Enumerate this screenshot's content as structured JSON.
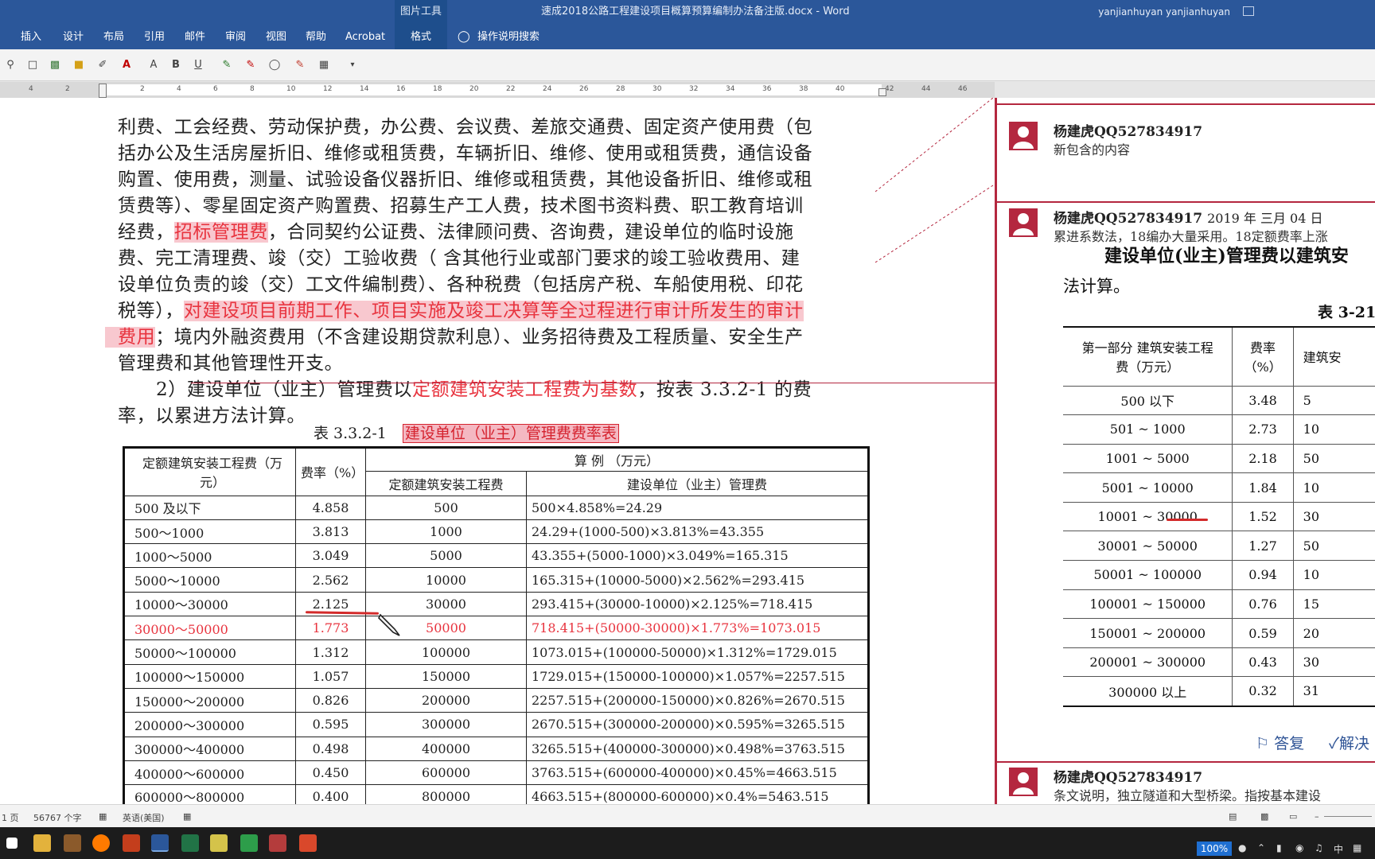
{
  "titlebar": {
    "context_tab": "图片工具",
    "doc_title": "速成2018公路工程建设项目概算预算编制办法备注版.docx  -  Word",
    "user": "yanjianhuyan yanjianhuyan"
  },
  "ribbon": {
    "tabs": [
      "插入",
      "设计",
      "布局",
      "引用",
      "邮件",
      "审阅",
      "视图",
      "帮助",
      "Acrobat",
      "格式"
    ],
    "tellme": "操作说明搜索"
  },
  "ruler": {
    "numbers": [
      "4",
      "2",
      "2",
      "4",
      "6",
      "8",
      "10",
      "12",
      "14",
      "16",
      "18",
      "20",
      "22",
      "24",
      "26",
      "28",
      "30",
      "32",
      "34",
      "36",
      "38",
      "40",
      "42",
      "44",
      "46"
    ]
  },
  "body": {
    "line1": "利费、工会经费、劳动保护费，办公费、会议费、差旅交通费、固定资产使用费（包",
    "line2": "括办公及生活房屋折旧、维修或租赁费，车辆折旧、维修、使用或租赁费，通信设备",
    "line3": "购置、使用费，测量、试验设备仪器折旧、维修或租赁费，其他设备折旧、维修或租",
    "line4": "赁费等）、零星固定资产购置费、招募生产工人费，技术图书资料费、职工教育培训",
    "line5_a": "经费，",
    "line5_hl": "招标管理费",
    "line5_b": "，合同契约公证费、法律顾问费、咨询费，建设单位的临时设施",
    "line6": "费、完工清理费、竣（交）工验收费（ 含其他行业或部门要求的竣工验收费用、建",
    "line7": "设单位负责的竣（交）工文件编制费）、各种税费（包括房产税、车船使用税、印花",
    "line8_a": "税等），",
    "line8_hl": "对建设项目前期工作、项目实施及竣工决算等全过程进行审计所发生的审计",
    "line9_hl": "费用",
    "line9_b": "；境内外融资费用（不含建设期贷款利息）、业务招待费及工程质量、安全生产",
    "line10": "管理费和其他管理性开支。",
    "para2_a": "2）建设单位（业主）管理费以",
    "para2_red": "定额建筑安装工程费为基数",
    "para2_b": "，按表 3.3.2-1 的费",
    "para2_line2": "率，以累进方法计算。",
    "caption_no": "表 3.3.2-1",
    "caption_title": "建设单位（业主）管理费费率表"
  },
  "fee_table": {
    "headers": {
      "col1": "定额建筑安装工程费（万元）",
      "col2": "费率（%）",
      "example": "算    例  （万元）",
      "sub1": "定额建筑安装工程费",
      "sub2": "建设单位（业主）管理费"
    },
    "rows": [
      [
        "500 及以下",
        "4.858",
        "500",
        "500×4.858%=24.29"
      ],
      [
        "500～1000",
        "3.813",
        "1000",
        "24.29+(1000-500)×3.813%=43.355"
      ],
      [
        "1000～5000",
        "3.049",
        "5000",
        "43.355+(5000-1000)×3.049%=165.315"
      ],
      [
        "5000～10000",
        "2.562",
        "10000",
        "165.315+(10000-5000)×2.562%=293.415"
      ],
      [
        "10000～30000",
        "2.125",
        "30000",
        "293.415+(30000-10000)×2.125%=718.415"
      ],
      [
        "30000～50000",
        "1.773",
        "50000",
        "718.415+(50000-30000)×1.773%=1073.015"
      ],
      [
        "50000～100000",
        "1.312",
        "100000",
        "1073.015+(100000-50000)×1.312%=1729.015"
      ],
      [
        "100000～150000",
        "1.057",
        "150000",
        "1729.015+(150000-100000)×1.057%=2257.515"
      ],
      [
        "150000～200000",
        "0.826",
        "200000",
        "2257.515+(200000-150000)×0.826%=2670.515"
      ],
      [
        "200000～300000",
        "0.595",
        "300000",
        "2670.515+(300000-200000)×0.595%=3265.515"
      ],
      [
        "300000～400000",
        "0.498",
        "400000",
        "3265.515+(400000-300000)×0.498%=3763.515"
      ],
      [
        "400000～600000",
        "0.450",
        "600000",
        "3763.515+(600000-400000)×0.45%=4663.515"
      ],
      [
        "600000～800000",
        "0.400",
        "800000",
        "4663.515+(800000-600000)×0.4%=5463.515"
      ]
    ]
  },
  "comments": [
    {
      "author": "杨建虎QQ527834917",
      "date": "",
      "text": "新包含的内容"
    },
    {
      "author": "杨建虎QQ527834917",
      "date": "2019 年 三月 04 日",
      "text": "累进系数法，18编办大量采用。18定额费率上涨"
    },
    {
      "author": "杨建虎QQ527834917",
      "date": "",
      "text": "条文说明，独立隧道和大型桥梁。指按基本建设"
    }
  ],
  "scan": {
    "title": "建设单位(业主)管理费以建筑安",
    "subtitle": "法计算。",
    "table_no": "表 3-21",
    "h1": "第一部分  建筑安装工程费（万元）",
    "h2": "费率（%）",
    "h3": "建筑安",
    "rows": [
      [
        "500 以下",
        "3.48",
        "5"
      ],
      [
        "501 ~ 1000",
        "2.73",
        "10"
      ],
      [
        "1001 ~ 5000",
        "2.18",
        "50"
      ],
      [
        "5001 ~ 10000",
        "1.84",
        "10"
      ],
      [
        "10001 ~ 30000",
        "1.52",
        "30"
      ],
      [
        "30001 ~ 50000",
        "1.27",
        "50"
      ],
      [
        "50001 ~ 100000",
        "0.94",
        "10"
      ],
      [
        "100001 ~ 150000",
        "0.76",
        "15"
      ],
      [
        "150001 ~ 200000",
        "0.59",
        "20"
      ],
      [
        "200001 ~ 300000",
        "0.43",
        "30"
      ],
      [
        "300000 以上",
        "0.32",
        "31"
      ]
    ],
    "reply": "答复",
    "resolve": "解决"
  },
  "status": {
    "page": "1 页",
    "words": "56767 个字",
    "lang": "英语(美国)",
    "zoom": "100%"
  },
  "tray": {
    "ime": "中"
  }
}
